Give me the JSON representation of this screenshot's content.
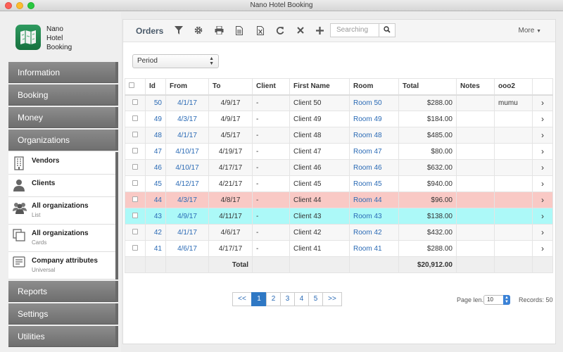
{
  "window": {
    "title": "Nano Hotel Booking"
  },
  "logo": {
    "line1": "Nano",
    "line2": "Hotel",
    "line3": "Booking"
  },
  "menu": {
    "information": "Information",
    "booking": "Booking",
    "money": "Money",
    "organizations": "Organizations",
    "reports": "Reports",
    "settings": "Settings",
    "utilities": "Utilities"
  },
  "submenu": [
    {
      "title": "Vendors",
      "desc": "",
      "icon": "building-icon"
    },
    {
      "title": "Clients",
      "desc": "",
      "icon": "person-icon"
    },
    {
      "title": "All organizations",
      "desc": "List",
      "icon": "group-icon"
    },
    {
      "title": "All organizations",
      "desc": "Cards",
      "icon": "cards-icon"
    },
    {
      "title": "Company attributes",
      "desc": "Universal",
      "icon": "attributes-icon"
    }
  ],
  "toolbar": {
    "title": "Orders",
    "search_placeholder": "Searching",
    "more": "More"
  },
  "filter": {
    "period": "Period"
  },
  "table": {
    "headers": {
      "id": "Id",
      "from": "From",
      "to": "To",
      "client": "Client",
      "first_name": "First Name",
      "room": "Room",
      "total": "Total",
      "notes": "Notes",
      "ooo2": "ooo2"
    },
    "rows": [
      {
        "id": "50",
        "from": "4/1/17",
        "to": "4/9/17",
        "client": "-",
        "first_name": "Client 50",
        "room": "Room 50",
        "total": "$288.00",
        "notes": "",
        "ooo2": "mumu"
      },
      {
        "id": "49",
        "from": "4/3/17",
        "to": "4/9/17",
        "client": "-",
        "first_name": "Client 49",
        "room": "Room 49",
        "total": "$184.00",
        "notes": "",
        "ooo2": ""
      },
      {
        "id": "48",
        "from": "4/1/17",
        "to": "4/5/17",
        "client": "-",
        "first_name": "Client 48",
        "room": "Room 48",
        "total": "$485.00",
        "notes": "",
        "ooo2": ""
      },
      {
        "id": "47",
        "from": "4/10/17",
        "to": "4/19/17",
        "client": "-",
        "first_name": "Client 47",
        "room": "Room 47",
        "total": "$80.00",
        "notes": "",
        "ooo2": ""
      },
      {
        "id": "46",
        "from": "4/10/17",
        "to": "4/17/17",
        "client": "-",
        "first_name": "Client 46",
        "room": "Room 46",
        "total": "$632.00",
        "notes": "",
        "ooo2": ""
      },
      {
        "id": "45",
        "from": "4/12/17",
        "to": "4/21/17",
        "client": "-",
        "first_name": "Client 45",
        "room": "Room 45",
        "total": "$940.00",
        "notes": "",
        "ooo2": ""
      },
      {
        "id": "44",
        "from": "4/3/17",
        "to": "4/8/17",
        "client": "-",
        "first_name": "Client 44",
        "room": "Room 44",
        "total": "$96.00",
        "notes": "",
        "ooo2": ""
      },
      {
        "id": "43",
        "from": "4/9/17",
        "to": "4/11/17",
        "client": "-",
        "first_name": "Client 43",
        "room": "Room 43",
        "total": "$138.00",
        "notes": "",
        "ooo2": ""
      },
      {
        "id": "42",
        "from": "4/1/17",
        "to": "4/6/17",
        "client": "-",
        "first_name": "Client 42",
        "room": "Room 42",
        "total": "$432.00",
        "notes": "",
        "ooo2": ""
      },
      {
        "id": "41",
        "from": "4/6/17",
        "to": "4/17/17",
        "client": "-",
        "first_name": "Client 41",
        "room": "Room 41",
        "total": "$288.00",
        "notes": "",
        "ooo2": ""
      }
    ],
    "total_label": "Total",
    "total_value": "$20,912.00"
  },
  "pagination": {
    "first": "<<",
    "pages": [
      "1",
      "2",
      "3",
      "4",
      "5"
    ],
    "active_page": "1",
    "last": ">>",
    "page_len_label": "Page len.",
    "page_len": "10",
    "records": "Records: 50"
  },
  "colors": {
    "highlight_red": "#f9c9c5",
    "highlight_cyan": "#acf9f8",
    "link": "#2a6ab5",
    "active_page": "#2f78c4"
  }
}
